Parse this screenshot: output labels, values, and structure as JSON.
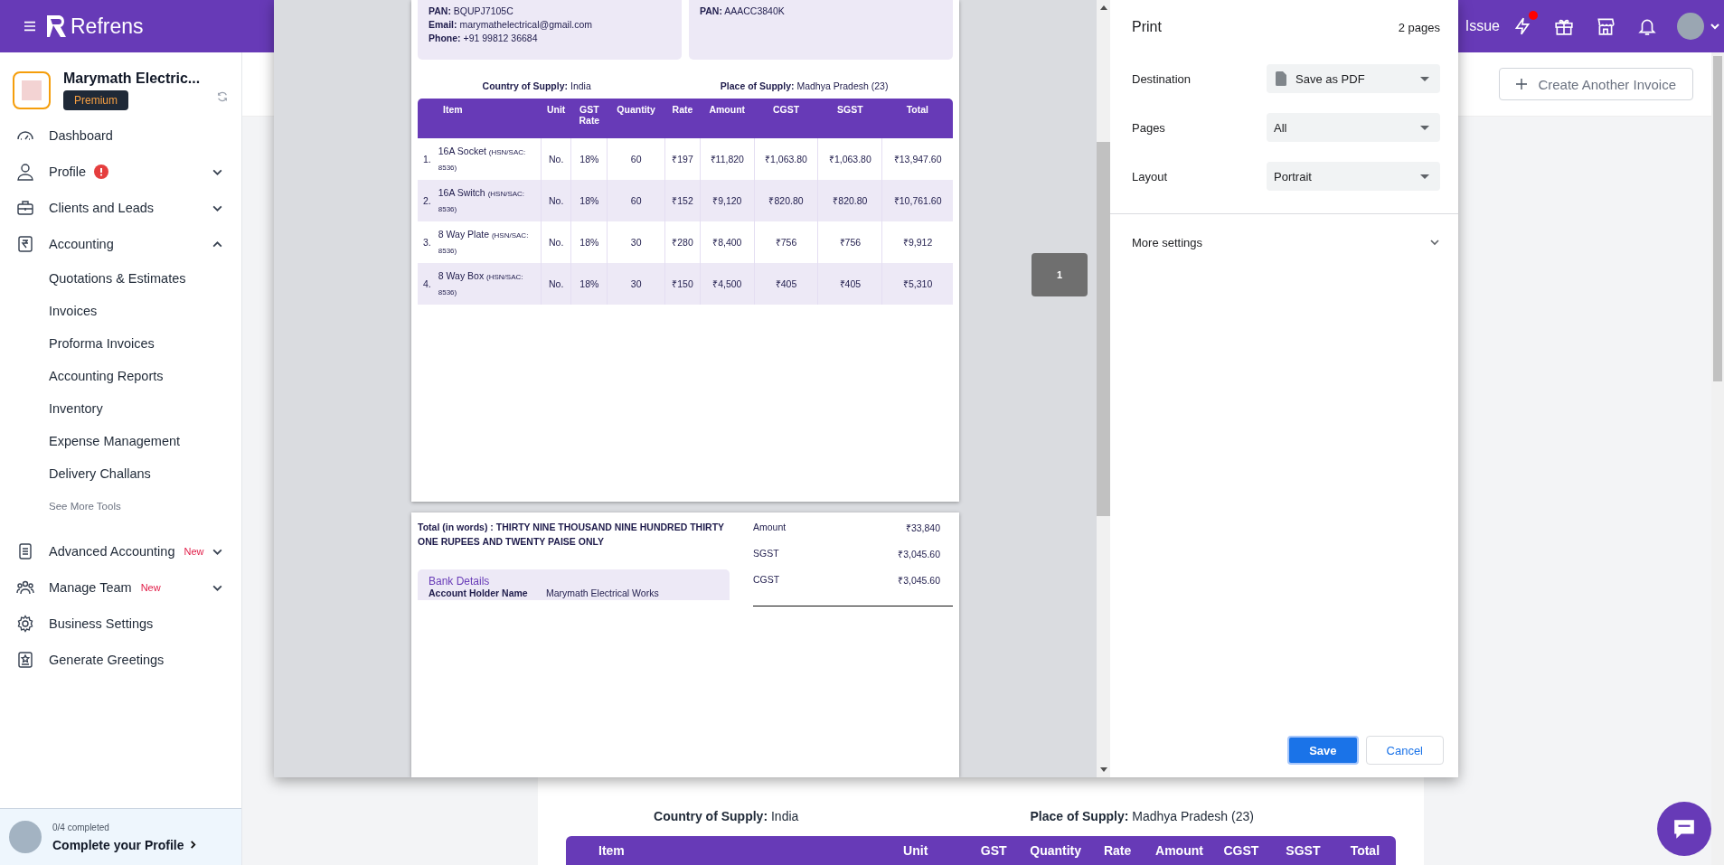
{
  "header": {
    "brand": "Refrens",
    "cut_label": "Issue",
    "notification_dot": true
  },
  "sidebar": {
    "company": {
      "name": "Marymath Electric...",
      "badge": "Premium"
    },
    "items": [
      {
        "label": "Dashboard"
      },
      {
        "label": "Profile",
        "alert": true,
        "expanded": false
      },
      {
        "label": "Clients and Leads",
        "expanded": false
      },
      {
        "label": "Accounting",
        "expanded": true,
        "children": [
          {
            "label": "Quotations & Estimates",
            "kind": "link"
          },
          {
            "label": "Invoices",
            "kind": "link"
          },
          {
            "label": "Proforma Invoices",
            "kind": "link"
          },
          {
            "label": "Accounting Reports",
            "kind": "link"
          },
          {
            "label": "Inventory",
            "kind": "link"
          },
          {
            "label": "Expense Management",
            "kind": "link"
          },
          {
            "label": "Delivery Challans",
            "kind": "link"
          },
          {
            "label": "See More Tools",
            "kind": "more"
          }
        ]
      },
      {
        "label": "Advanced Accounting",
        "tag": "New",
        "expanded": false
      },
      {
        "label": "Manage Team",
        "tag": "New",
        "expanded": false
      },
      {
        "label": "Business Settings"
      },
      {
        "label": "Generate Greetings"
      }
    ],
    "progress": {
      "count": "0/4 completed",
      "label": "Complete your Profile"
    }
  },
  "toolbar": {
    "create_button": "Create Another Invoice"
  },
  "invoice_behind": {
    "supply": [
      {
        "label": "Country of Supply:",
        "value": "India"
      },
      {
        "label": "Place of Supply:",
        "value": "Madhya Pradesh (23)"
      }
    ],
    "columns": [
      "Item",
      "Unit",
      "GST",
      "Quantity",
      "Rate",
      "Amount",
      "CGST",
      "SGST",
      "Total"
    ]
  },
  "print_dialog": {
    "title": "Print",
    "page_count": "2 pages",
    "settings": [
      {
        "label": "Destination",
        "value": "Save as PDF",
        "kind": "pdf"
      },
      {
        "label": "Pages",
        "value": "All",
        "kind": "plain"
      },
      {
        "label": "Layout",
        "value": "Portrait",
        "kind": "plain"
      }
    ],
    "more_settings": {
      "label": "More settings",
      "expanded": false
    },
    "buttons": [
      {
        "label": "Save",
        "kind": "primary"
      },
      {
        "label": "Cancel",
        "kind": "secondary"
      }
    ],
    "page_badge": "1",
    "preview": {
      "page_1": {
        "seller": [
          {
            "label": "PAN:",
            "value": "BQUPJ7105C"
          },
          {
            "label": "Email:",
            "value": "marymathelectrical@gmail.com"
          },
          {
            "label": "Phone:",
            "value": "+91 99812 36684"
          }
        ],
        "buyer": [
          {
            "label": "PAN:",
            "value": "AAACC3840K"
          }
        ],
        "supply": [
          {
            "label": "Country of Supply:",
            "value": "India"
          },
          {
            "label": "Place of Supply:",
            "value": "Madhya Pradesh (23)"
          }
        ],
        "item_column": "Item",
        "columns": [
          "Unit",
          "GST Rate",
          "Quantity",
          "Rate",
          "Amount",
          "CGST",
          "SGST",
          "Total"
        ],
        "rows": [
          {
            "item": {
              "no": "1.",
              "name": "16A Socket",
              "hsn": "(HSN/SAC: 8536)"
            },
            "cells": [
              "No.",
              "18%",
              "60",
              "₹197",
              "₹11,820",
              "₹1,063.80",
              "₹1,063.80",
              "₹13,947.60"
            ]
          },
          {
            "item": {
              "no": "2.",
              "name": "16A Switch",
              "hsn": "(HSN/SAC: 8536)"
            },
            "cells": [
              "No.",
              "18%",
              "60",
              "₹152",
              "₹9,120",
              "₹820.80",
              "₹820.80",
              "₹10,761.60"
            ]
          },
          {
            "item": {
              "no": "3.",
              "name": "8 Way Plate",
              "hsn": "(HSN/SAC: 8536)"
            },
            "cells": [
              "No.",
              "18%",
              "30",
              "₹280",
              "₹8,400",
              "₹756",
              "₹756",
              "₹9,912"
            ]
          },
          {
            "item": {
              "no": "4.",
              "name": "8 Way Box",
              "hsn": "(HSN/SAC: 8536)"
            },
            "cells": [
              "No.",
              "18%",
              "30",
              "₹150",
              "₹4,500",
              "₹405",
              "₹405",
              "₹5,310"
            ]
          }
        ]
      },
      "page_2": {
        "total_in_words": "Total (in words) : THIRTY NINE THOUSAND NINE HUNDRED THIRTY ONE RUPEES AND TWENTY PAISE ONLY",
        "summary": [
          {
            "label": "Amount",
            "value": "₹33,840"
          },
          {
            "label": "SGST",
            "value": "₹3,045.60"
          },
          {
            "label": "CGST",
            "value": "₹3,045.60"
          }
        ],
        "bank_details": {
          "title": "Bank Details",
          "rows": [
            {
              "label": "Account Holder Name",
              "value": "Marymath Electrical Works"
            }
          ]
        }
      }
    }
  }
}
